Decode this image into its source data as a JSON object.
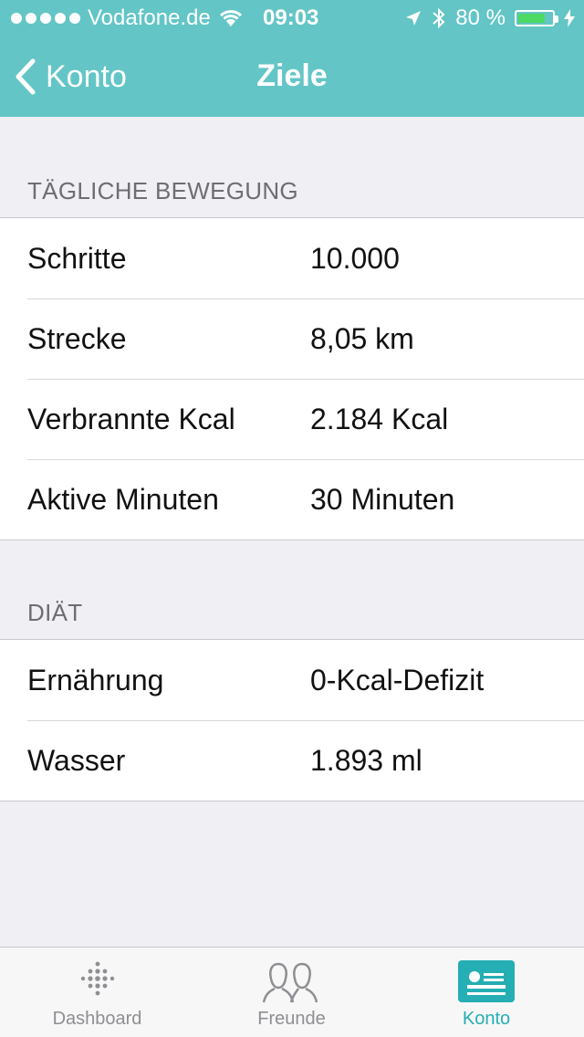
{
  "status_bar": {
    "carrier": "Vodafone.de",
    "time": "09:03",
    "battery": "80 %",
    "battery_level": 0.8
  },
  "nav": {
    "back_label": "Konto",
    "title": "Ziele"
  },
  "sections": [
    {
      "title": "TÄGLICHE BEWEGUNG",
      "rows": [
        {
          "label": "Schritte",
          "value": "10.000"
        },
        {
          "label": "Strecke",
          "value": "8,05 km"
        },
        {
          "label": "Verbrannte Kcal",
          "value": "2.184 Kcal"
        },
        {
          "label": "Aktive Minuten",
          "value": "30 Minuten"
        }
      ]
    },
    {
      "title": "DIÄT",
      "rows": [
        {
          "label": "Ernährung",
          "value": "0-Kcal-Defizit"
        },
        {
          "label": "Wasser",
          "value": "1.893 ml"
        }
      ]
    }
  ],
  "tabbar": {
    "tabs": [
      {
        "label": "Dashboard",
        "icon": "dashboard-dots-icon"
      },
      {
        "label": "Freunde",
        "icon": "friends-icon"
      },
      {
        "label": "Konto",
        "icon": "account-card-icon",
        "active": true
      }
    ]
  },
  "colors": {
    "header": "#63c5c6",
    "accent": "#25aeb3",
    "background": "#efeff4",
    "battery_fill": "#4cd964"
  }
}
